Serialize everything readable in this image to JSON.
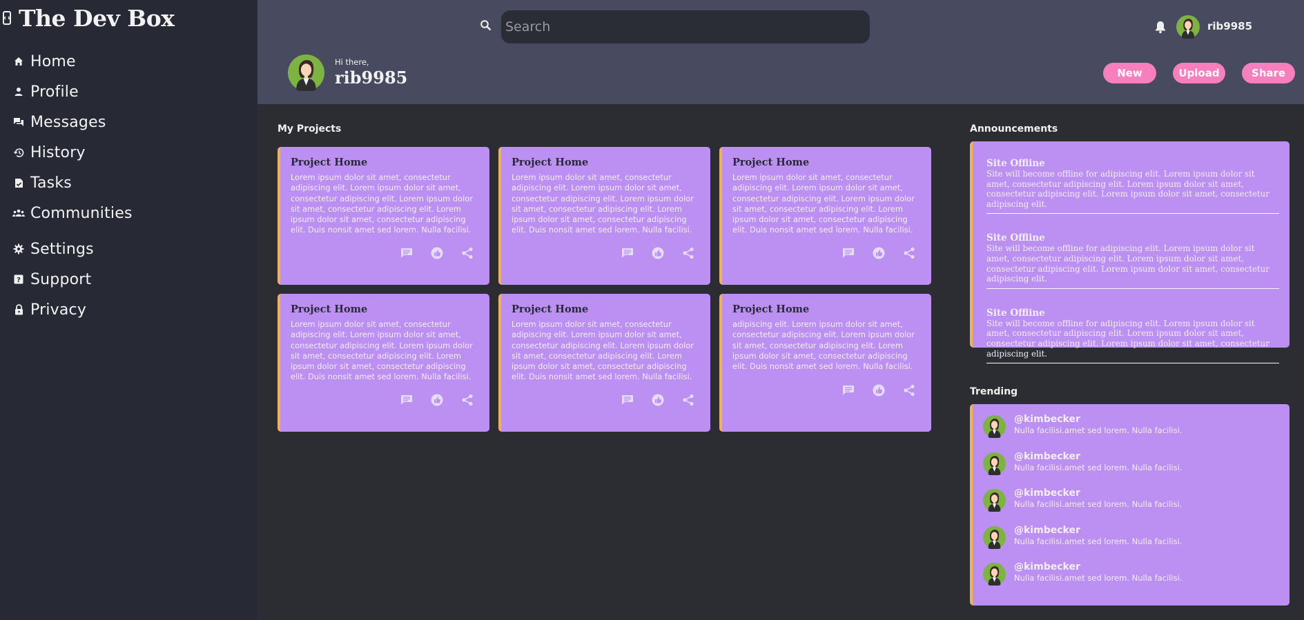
{
  "brand": {
    "title": "The Dev Box",
    "icon": "code-box-icon"
  },
  "sidebar": {
    "items": [
      {
        "label": "Home",
        "icon": "home-icon"
      },
      {
        "label": "Profile",
        "icon": "person-icon"
      },
      {
        "label": "Messages",
        "icon": "messages-icon"
      },
      {
        "label": "History",
        "icon": "history-icon"
      },
      {
        "label": "Tasks",
        "icon": "task-icon"
      },
      {
        "label": "Communities",
        "icon": "group-icon"
      },
      {
        "label": "Settings",
        "icon": "gear-icon"
      },
      {
        "label": "Support",
        "icon": "help-icon"
      },
      {
        "label": "Privacy",
        "icon": "lock-icon"
      }
    ]
  },
  "header": {
    "search_placeholder": "Search",
    "username": "rib9985",
    "greeting": "Hi there,",
    "greet_name": "rib9985",
    "buttons": {
      "new": "New",
      "upload": "Upload",
      "share": "Share"
    }
  },
  "projects": {
    "title": "My Projects",
    "cards": [
      {
        "title": "Project Home",
        "text": "Lorem ipsum dolor sit amet, consectetur adipiscing elit. Lorem ipsum dolor sit amet, consectetur adipiscing elit. Lorem ipsum dolor sit amet, consectetur adipiscing elit. Lorem ipsum dolor sit amet, consectetur adipiscing elit. Duis nonsit amet sed lorem. Nulla facilisi."
      },
      {
        "title": "Project Home",
        "text": "Lorem ipsum dolor sit amet, consectetur adipiscing elit. Lorem ipsum dolor sit amet, consectetur adipiscing elit. Lorem ipsum dolor sit amet, consectetur adipiscing elit. Lorem ipsum dolor sit amet, consectetur adipiscing elit. Duis nonsit amet sed lorem. Nulla facilisi."
      },
      {
        "title": "Project Home",
        "text": "Lorem ipsum dolor sit amet, consectetur adipiscing elit. Lorem ipsum dolor sit amet, consectetur adipiscing elit. Lorem ipsum dolor sit amet, consectetur adipiscing elit. Lorem ipsum dolor sit amet, consectetur adipiscing elit. Duis nonsit amet sed lorem. Nulla facilisi."
      },
      {
        "title": "Project Home",
        "text": "Lorem ipsum dolor sit amet, consectetur adipiscing elit. Lorem ipsum dolor sit amet, consectetur adipiscing elit. Lorem ipsum dolor sit amet, consectetur adipiscing elit. Lorem ipsum dolor sit amet, consectetur adipiscing elit. Duis nonsit amet sed lorem. Nulla facilisi."
      },
      {
        "title": "Project Home",
        "text": "Lorem ipsum dolor sit amet, consectetur adipiscing elit. Lorem ipsum dolor sit amet, consectetur adipiscing elit. Lorem ipsum dolor sit amet, consectetur adipiscing elit. Lorem ipsum dolor sit amet, consectetur adipiscing elit. Duis nonsit amet sed lorem. Nulla facilisi."
      },
      {
        "title": "Project Home",
        "text": "adipiscing elit. Lorem ipsum dolor sit amet, consectetur adipiscing elit. Lorem ipsum dolor sit amet, consectetur adipiscing elit. Lorem ipsum dolor sit amet, consectetur adipiscing elit. Duis nonsit amet sed lorem. Nulla facilisi."
      }
    ],
    "action_icons": [
      "comment-icon",
      "like-icon",
      "share-icon"
    ]
  },
  "announcements": {
    "title": "Announcements",
    "items": [
      {
        "title": "Site Offline",
        "text": "Site will become offline for adipiscing elit. Lorem ipsum dolor sit amet, consectetur adipiscing elit. Lorem ipsum dolor sit amet, consectetur adipiscing elit. Lorem ipsum dolor sit amet, consectetur adipiscing elit."
      },
      {
        "title": "Site Offline",
        "text": "Site will become offline for adipiscing elit. Lorem ipsum dolor sit amet, consectetur adipiscing elit. Lorem ipsum dolor sit amet, consectetur adipiscing elit. Lorem ipsum dolor sit amet, consectetur adipiscing elit."
      },
      {
        "title": "Site Offline",
        "text": "Site will become offline for adipiscing elit. Lorem ipsum dolor sit amet, consectetur adipiscing elit. Lorem ipsum dolor sit amet, consectetur adipiscing elit. Lorem ipsum dolor sit amet, consectetur adipiscing elit."
      }
    ]
  },
  "trending": {
    "title": "Trending",
    "items": [
      {
        "handle": "@kimbecker",
        "text": "Nulla facilisi.amet sed lorem. Nulla facilisi."
      },
      {
        "handle": "@kimbecker",
        "text": "Nulla facilisi.amet sed lorem. Nulla facilisi."
      },
      {
        "handle": "@kimbecker",
        "text": "Nulla facilisi.amet sed lorem. Nulla facilisi."
      },
      {
        "handle": "@kimbecker",
        "text": "Nulla facilisi.amet sed lorem. Nulla facilisi."
      },
      {
        "handle": "@kimbecker",
        "text": "Nulla facilisi.amet sed lorem. Nulla facilisi."
      }
    ]
  },
  "colors": {
    "sidebar_bg": "#272935",
    "header_bg": "#484b60",
    "main_bg": "#2c2d33",
    "card_bg": "#bc8ff3",
    "card_accent": "#f0b05a",
    "button_pink": "#f77fbe"
  }
}
